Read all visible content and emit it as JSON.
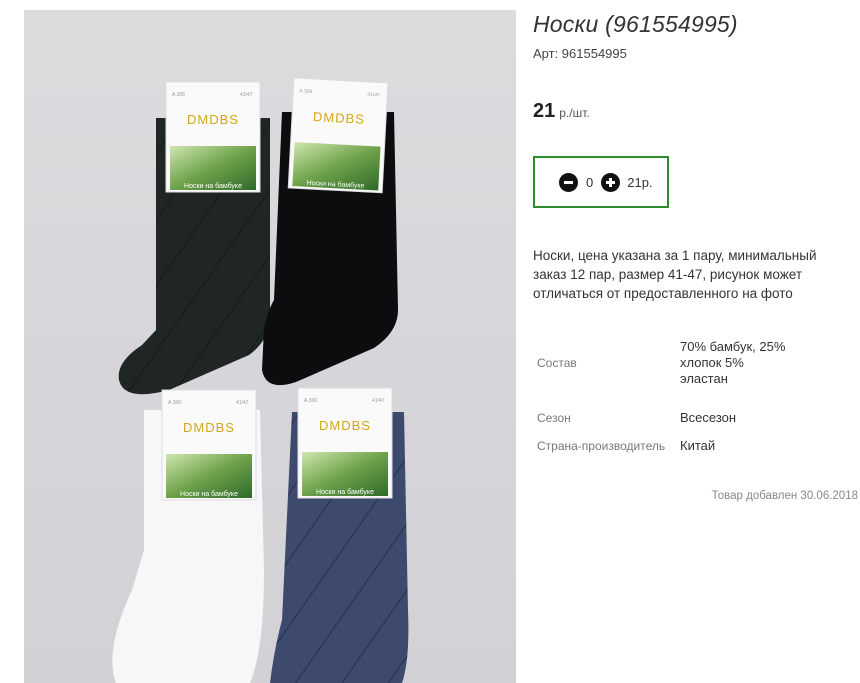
{
  "product": {
    "title": "Носки (961554995)",
    "sku_label": "Арт: 961554995",
    "price_value": "21",
    "price_unit": "р./шт.",
    "description": "Носки, цена указана за 1 пару, минимальный заказ 12 пар, размер 41-47, рисунок может отличаться от предоставленного на фото",
    "added_text": "Товар добавлен 30.06.2018"
  },
  "cart": {
    "quantity": "0",
    "sum": "21р.",
    "accent_color": "#2e8b2e"
  },
  "properties": [
    {
      "label": "Состав",
      "value": "70% бамбук, 25% хлопок 5% эластан"
    },
    {
      "label": "Сезон",
      "value": "Всесезон"
    },
    {
      "label": "Страна-производитель",
      "value": "Китай"
    }
  ],
  "photo": {
    "brand": "DMDBS",
    "tag_caption": "Носки на бамбуке",
    "tag_code": "A.306",
    "tag_size": "41/47",
    "sock_colors": [
      "#1f2624",
      "#0d0d0f",
      "#f7f7f7",
      "#3d4a6e"
    ]
  }
}
